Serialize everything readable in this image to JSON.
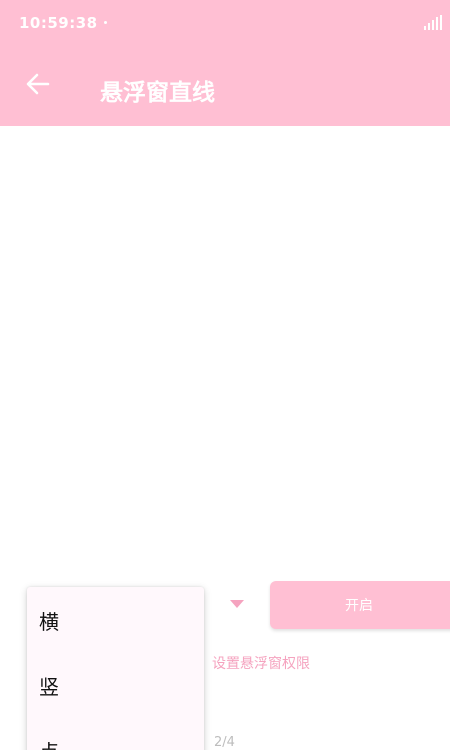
{
  "status_bar": {
    "time": "10:59:38",
    "signal_icon": "signal-icon"
  },
  "app_bar": {
    "back_icon": "arrow-left-icon",
    "title": "悬浮窗直线",
    "color": "#ffbfd3"
  },
  "controls": {
    "dropdown_icon": "caret-down-icon",
    "start_button_label": "开启",
    "permission_link": "设置悬浮窗权限",
    "page_indicator": "2/4"
  },
  "dropdown_menu": {
    "items": [
      "横",
      "竖",
      "点"
    ]
  }
}
